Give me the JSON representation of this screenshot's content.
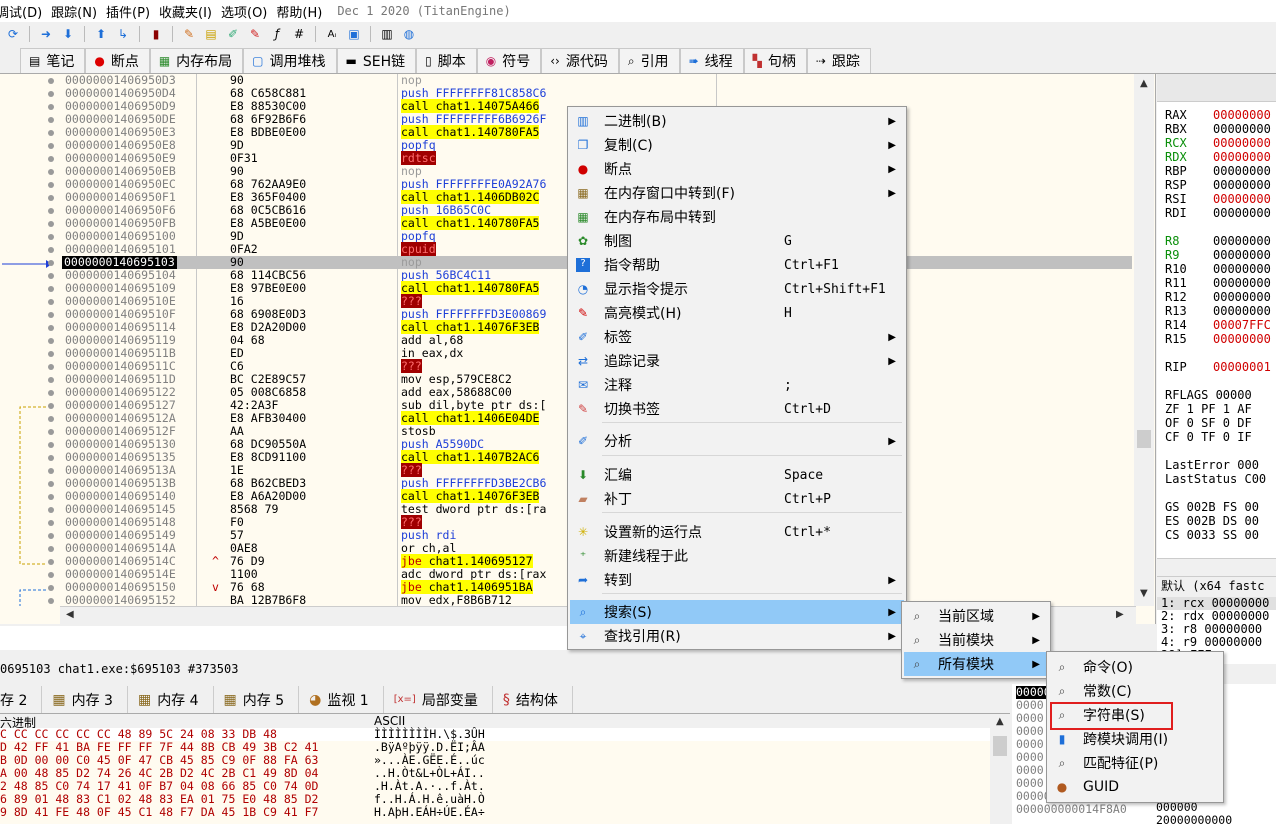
{
  "menubar": {
    "items": [
      "调试(D)",
      "跟踪(N)",
      "插件(P)",
      "收藏夹(I)",
      "选项(O)",
      "帮助(H)"
    ],
    "build": "Dec 1 2020 (TitanEngine)"
  },
  "tabs": [
    {
      "label": "笔记",
      "icon": "notes-icon"
    },
    {
      "label": "断点",
      "icon": "breakpoint-icon"
    },
    {
      "label": "内存布局",
      "icon": "memory-map-icon"
    },
    {
      "label": "调用堆栈",
      "icon": "callstack-icon"
    },
    {
      "label": "SEH链",
      "icon": "seh-icon"
    },
    {
      "label": "脚本",
      "icon": "script-icon"
    },
    {
      "label": "符号",
      "icon": "symbols-icon"
    },
    {
      "label": "源代码",
      "icon": "source-icon"
    },
    {
      "label": "引用",
      "icon": "references-icon"
    },
    {
      "label": "线程",
      "icon": "threads-icon"
    },
    {
      "label": "句柄",
      "icon": "handles-icon"
    },
    {
      "label": "跟踪",
      "icon": "trace-icon"
    }
  ],
  "disasm": [
    {
      "addr": "00000001406950D3",
      "bytes": "90",
      "mn": "nop",
      "ops": "",
      "kind": "nop"
    },
    {
      "addr": "00000001406950D4",
      "bytes": "68 C658C881",
      "mn": "push",
      "ops": "FFFFFFFF81C858C6",
      "kind": "push"
    },
    {
      "addr": "00000001406950D9",
      "bytes": "E8 88530C00",
      "mn": "call",
      "ops": "chat1.14075A466",
      "kind": "call"
    },
    {
      "addr": "00000001406950DE",
      "bytes": "68 6F92B6F6",
      "mn": "push",
      "ops": "FFFFFFFFF6B6926F",
      "kind": "push"
    },
    {
      "addr": "00000001406950E3",
      "bytes": "E8 BDBE0E00",
      "mn": "call",
      "ops": "chat1.140780FA5",
      "kind": "call"
    },
    {
      "addr": "00000001406950E8",
      "bytes": "9D",
      "mn": "popfq",
      "ops": "",
      "kind": "pop"
    },
    {
      "addr": "00000001406950E9",
      "bytes": "0F31",
      "mn": "rdtsc",
      "ops": "",
      "kind": "bad"
    },
    {
      "addr": "00000001406950EB",
      "bytes": "90",
      "mn": "nop",
      "ops": "",
      "kind": "nop"
    },
    {
      "addr": "00000001406950EC",
      "bytes": "68 762AA9E0",
      "mn": "push",
      "ops": "FFFFFFFFE0A92A76",
      "kind": "push"
    },
    {
      "addr": "00000001406950F1",
      "bytes": "E8 365F0400",
      "mn": "call",
      "ops": "chat1.1406DB02C",
      "kind": "call"
    },
    {
      "addr": "00000001406950F6",
      "bytes": "68 0C5CB616",
      "mn": "push",
      "ops": "16B65C0C",
      "kind": "push"
    },
    {
      "addr": "00000001406950FB",
      "bytes": "E8 A5BE0E00",
      "mn": "call",
      "ops": "chat1.140780FA5",
      "kind": "call"
    },
    {
      "addr": "0000000140695100",
      "bytes": "9D",
      "mn": "popfq",
      "ops": "",
      "kind": "pop"
    },
    {
      "addr": "0000000140695101",
      "bytes": "0FA2",
      "mn": "cpuid",
      "ops": "",
      "kind": "bad"
    },
    {
      "addr": "0000000140695103",
      "bytes": "90",
      "mn": "nop",
      "ops": "",
      "kind": "nop",
      "current": true
    },
    {
      "addr": "0000000140695104",
      "bytes": "68 114CBC56",
      "mn": "push",
      "ops": "56BC4C11",
      "kind": "push"
    },
    {
      "addr": "0000000140695109",
      "bytes": "E8 97BE0E00",
      "mn": "call",
      "ops": "chat1.140780FA5",
      "kind": "call"
    },
    {
      "addr": "000000014069510E",
      "bytes": "16",
      "mn": "???",
      "ops": "",
      "kind": "bad"
    },
    {
      "addr": "000000014069510F",
      "bytes": "68 6908E0D3",
      "mn": "push",
      "ops": "FFFFFFFFD3E00869",
      "kind": "push"
    },
    {
      "addr": "0000000140695114",
      "bytes": "E8 D2A20D00",
      "mn": "call",
      "ops": "chat1.14076F3EB",
      "kind": "call"
    },
    {
      "addr": "0000000140695119",
      "bytes": "04 68",
      "mn": "add",
      "ops": "al,68",
      "kind": "plain"
    },
    {
      "addr": "000000014069511B",
      "bytes": "ED",
      "mn": "in",
      "ops": "eax,dx",
      "kind": "plain"
    },
    {
      "addr": "000000014069511C",
      "bytes": "C6",
      "mn": "???",
      "ops": "",
      "kind": "bad"
    },
    {
      "addr": "000000014069511D",
      "bytes": "BC C2E89C57",
      "mn": "mov",
      "ops": "esp,579CE8C2",
      "kind": "plain"
    },
    {
      "addr": "0000000140695122",
      "bytes": "05 008C6858",
      "mn": "add",
      "ops": "eax,58688C00",
      "kind": "plain"
    },
    {
      "addr": "0000000140695127",
      "bytes": "42:2A3F",
      "mn": "sub",
      "ops": "dil,byte ptr ds:[",
      "kind": "plain"
    },
    {
      "addr": "000000014069512A",
      "bytes": "E8 AFB30400",
      "mn": "call",
      "ops": "chat1.1406E04DE",
      "kind": "call"
    },
    {
      "addr": "000000014069512F",
      "bytes": "AA",
      "mn": "stosb",
      "ops": "",
      "kind": "plain"
    },
    {
      "addr": "0000000140695130",
      "bytes": "68 DC90550A",
      "mn": "push",
      "ops": "A5590DC",
      "kind": "push"
    },
    {
      "addr": "0000000140695135",
      "bytes": "E8 8CD91100",
      "mn": "call",
      "ops": "chat1.1407B2AC6",
      "kind": "call"
    },
    {
      "addr": "000000014069513A",
      "bytes": "1E",
      "mn": "???",
      "ops": "",
      "kind": "bad"
    },
    {
      "addr": "000000014069513B",
      "bytes": "68 B62CBED3",
      "mn": "push",
      "ops": "FFFFFFFFD3BE2CB6",
      "kind": "push"
    },
    {
      "addr": "0000000140695140",
      "bytes": "E8 A6A20D00",
      "mn": "call",
      "ops": "chat1.14076F3EB",
      "kind": "call"
    },
    {
      "addr": "0000000140695145",
      "bytes": "8568 79",
      "mn": "test",
      "ops": "dword ptr ds:[ra",
      "kind": "plain"
    },
    {
      "addr": "0000000140695148",
      "bytes": "F0",
      "mn": "???",
      "ops": "",
      "kind": "bad"
    },
    {
      "addr": "0000000140695149",
      "bytes": "57",
      "mn": "push",
      "ops": "rdi",
      "kind": "push"
    },
    {
      "addr": "000000014069514A",
      "bytes": "0AE8",
      "mn": "or",
      "ops": "ch,al",
      "kind": "plain"
    },
    {
      "addr": "000000014069514C",
      "bytes": "76 D9",
      "mn": "jbe",
      "ops": "chat1.140695127",
      "kind": "jump",
      "mark": "^"
    },
    {
      "addr": "000000014069514E",
      "bytes": "1100",
      "mn": "adc",
      "ops": "dword ptr ds:[rax",
      "kind": "plain"
    },
    {
      "addr": "0000000140695150",
      "bytes": "76 68",
      "mn": "jbe",
      "ops": "chat1.1406951BA",
      "kind": "jump",
      "mark": "v"
    },
    {
      "addr": "0000000140695152",
      "bytes": "BA 12B7B6F8",
      "mn": "mov",
      "ops": "edx,F8B6B712",
      "kind": "plain"
    }
  ],
  "registers": [
    {
      "name": "RAX",
      "value": "00000000",
      "name_color": "#000000",
      "value_color": "#d00000"
    },
    {
      "name": "RBX",
      "value": "00000000",
      "name_color": "#000000",
      "value_color": "#000000"
    },
    {
      "name": "RCX",
      "value": "00000000",
      "name_color": "#0a8f0a",
      "value_color": "#d00000"
    },
    {
      "name": "RDX",
      "value": "00000000",
      "name_color": "#0a8f0a",
      "value_color": "#d00000"
    },
    {
      "name": "RBP",
      "value": "00000000",
      "name_color": "#000000",
      "value_color": "#000000"
    },
    {
      "name": "RSP",
      "value": "00000000",
      "name_color": "#000000",
      "value_color": "#000000"
    },
    {
      "name": "RSI",
      "value": "00000000",
      "name_color": "#000000",
      "value_color": "#d00000"
    },
    {
      "name": "RDI",
      "value": "00000000",
      "name_color": "#000000",
      "value_color": "#000000"
    },
    {
      "name": "R8",
      "value": "00000000",
      "name_color": "#0a8f0a",
      "value_color": "#000000"
    },
    {
      "name": "R9",
      "value": "00000000",
      "name_color": "#0a8f0a",
      "value_color": "#000000"
    },
    {
      "name": "R10",
      "value": "00000000",
      "name_color": "#000000",
      "value_color": "#000000"
    },
    {
      "name": "R11",
      "value": "00000000",
      "name_color": "#000000",
      "value_color": "#000000"
    },
    {
      "name": "R12",
      "value": "00000000",
      "name_color": "#000000",
      "value_color": "#000000"
    },
    {
      "name": "R13",
      "value": "00000000",
      "name_color": "#000000",
      "value_color": "#000000"
    },
    {
      "name": "R14",
      "value": "00007FFC",
      "name_color": "#000000",
      "value_color": "#d00000"
    },
    {
      "name": "R15",
      "value": "00000000",
      "name_color": "#000000",
      "value_color": "#d00000"
    },
    {
      "name": "RIP",
      "value": "00000001",
      "name_color": "#000000",
      "value_color": "#d00000"
    }
  ],
  "flags": {
    "rflags": "RFLAGS   00000",
    "line1": "ZF 1  PF 1  AF",
    "line2": "OF 0  SF 0  DF",
    "line3": "CF 0  TF 0  IF",
    "lasterror": "LastError  000",
    "laststatus": "LastStatus C00",
    "seg1": "GS 002B  FS 00",
    "seg2": "ES 002B  DS 00",
    "seg3": "CS 0033  SS 00"
  },
  "callstack": {
    "header": "默认 (x64 fastc",
    "rows": [
      "1: rcx 00000000",
      "2: rdx 00000000",
      "3: r8 00000000",
      "4: r9 00000000",
      "     28] FFF"
    ]
  },
  "status": "0695103 chat1.exe:$695103 #373503",
  "bottom_tabs": [
    {
      "label": "存 2",
      "icon": "memory-icon"
    },
    {
      "label": "内存 3",
      "icon": "memory-icon"
    },
    {
      "label": "内存 4",
      "icon": "memory-icon"
    },
    {
      "label": "内存 5",
      "icon": "memory-icon"
    },
    {
      "label": "监视 1",
      "icon": "watch-icon"
    },
    {
      "label": "局部变量",
      "icon": "locals-icon"
    },
    {
      "label": "结构体",
      "icon": "struct-icon"
    }
  ],
  "dump": {
    "hex_header": "六进制",
    "ascii_header": "ASCII",
    "rows": [
      {
        "hex": "C CC CC CC CC CC 48 89 5C 24 08 33 DB 48",
        "ascii": "ÌÌÌÌÌÌÌÌH.\\$.3ÛH"
      },
      {
        "hex": "D 42 FF 41 BA FE FF FF 7F 44 8B CB 49 3B C2 41",
        "ascii": ".BÿAºþÿÿ.D.ËI;ÂA"
      },
      {
        "hex": "B 0D 00 00 C0 45 0F 47 CB 45 85 C9 0F 88 FA 63",
        "ascii": "»...ÀE.GËE.É..úc"
      },
      {
        "hex": "A 00 48 85 D2 74 26 4C 2B D2 4C 2B C1 49 8D 04",
        "ascii": "..H.Òt&L+ÒL+ÁI.."
      },
      {
        "hex": "2 48 85 C0 74 17 41 0F B7 04 08 66 85 C0 74 0D",
        "ascii": ".H.Àt.A.·..f.Àt."
      },
      {
        "hex": "6 89 01 48 83 C1 02 48 83 EA 01 75 E0 48 85 D2",
        "ascii": "f..H.Á.H.ê.uàH.Ò"
      },
      {
        "hex": "9 8D 41 FE 48 0F 45 C1 48 F7 DA 45 1B C9 41 F7",
        "ascii": "H.AþH.EÁH÷ÚE.ÉA÷"
      }
    ]
  },
  "stack_rows": [
    "00000",
    "0000",
    "0000",
    "0000",
    "0000",
    "0000",
    "0000",
    "0000",
    "000000000014F898",
    "000000000014F8A0"
  ],
  "stack_right": [
    "000000",
    "0033CBE",
    "000000",
    "000000",
    "007000",
    "000000",
    "FFFFFF",
    "014FBF",
    "000000",
    "000000",
    "20000000000",
    "000000"
  ],
  "context_menu": {
    "items": [
      {
        "label": "二进制(B)",
        "icon": "binary-icon",
        "shortcut": "",
        "submenu": true
      },
      {
        "label": "复制(C)",
        "icon": "copy-icon",
        "shortcut": "",
        "submenu": true
      },
      {
        "label": "断点",
        "icon": "breakpoint-icon",
        "shortcut": "",
        "submenu": true
      },
      {
        "label": "在内存窗口中转到(F)",
        "icon": "memory-goto-icon",
        "shortcut": "",
        "submenu": true
      },
      {
        "label": "在内存布局中转到",
        "icon": "memory-map-icon",
        "shortcut": "",
        "submenu": false
      },
      {
        "label": "制图",
        "icon": "graph-icon",
        "shortcut": "G",
        "submenu": false
      },
      {
        "label": "指令帮助",
        "icon": "help-icon",
        "shortcut": "Ctrl+F1",
        "submenu": false
      },
      {
        "label": "显示指令提示",
        "icon": "hint-icon",
        "shortcut": "Ctrl+Shift+F1",
        "submenu": false
      },
      {
        "label": "高亮模式(H)",
        "icon": "highlight-icon",
        "shortcut": "H",
        "submenu": false
      },
      {
        "label": "标签",
        "icon": "label-icon",
        "shortcut": "",
        "submenu": true
      },
      {
        "label": "追踪记录",
        "icon": "trace-record-icon",
        "shortcut": "",
        "submenu": true
      },
      {
        "label": "注释",
        "icon": "comment-icon",
        "shortcut": ";",
        "submenu": false
      },
      {
        "label": "切换书签",
        "icon": "bookmark-icon",
        "shortcut": "Ctrl+D",
        "submenu": false
      },
      {
        "label": "分析",
        "icon": "analyze-icon",
        "shortcut": "",
        "submenu": true
      },
      {
        "label": "汇编",
        "icon": "assemble-icon",
        "shortcut": "Space",
        "submenu": false
      },
      {
        "label": "补丁",
        "icon": "patch-icon",
        "shortcut": "Ctrl+P",
        "submenu": false
      },
      {
        "label": "设置新的运行点",
        "icon": "origin-icon",
        "shortcut": "Ctrl+*",
        "submenu": false
      },
      {
        "label": "新建线程于此",
        "icon": "new-thread-icon",
        "shortcut": "",
        "submenu": false
      },
      {
        "label": "转到",
        "icon": "goto-icon",
        "shortcut": "",
        "submenu": true
      },
      {
        "label": "搜索(S)",
        "icon": "search-icon",
        "shortcut": "",
        "submenu": true
      },
      {
        "label": "查找引用(R)",
        "icon": "find-refs-icon",
        "shortcut": "",
        "submenu": true
      }
    ]
  },
  "search_submenu": {
    "items": [
      {
        "label": "当前区域",
        "submenu": true
      },
      {
        "label": "当前模块",
        "submenu": true
      },
      {
        "label": "所有模块",
        "submenu": true
      }
    ]
  },
  "module_submenu": {
    "items": [
      {
        "label": "命令(O)",
        "icon": "command-icon"
      },
      {
        "label": "常数(C)",
        "icon": "constant-icon"
      },
      {
        "label": "字符串(S)",
        "icon": "string-icon"
      },
      {
        "label": "跨模块调用(I)",
        "icon": "intermodular-call-icon"
      },
      {
        "label": "匹配特征(P)",
        "icon": "pattern-icon"
      },
      {
        "label": "GUID",
        "icon": "guid-icon"
      }
    ]
  }
}
